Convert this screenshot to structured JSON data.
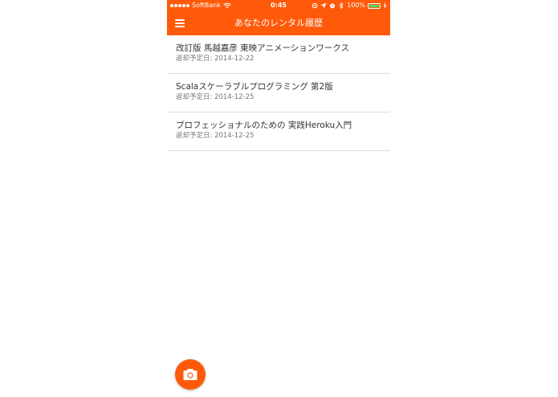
{
  "colors": {
    "accent": "#ff5a0a",
    "battery": "#4cd964"
  },
  "status_bar": {
    "carrier": "SoftBank",
    "time": "0:45",
    "battery_percent": "100%",
    "icons": [
      "signal-dots-icon",
      "wifi-icon",
      "location-icon",
      "alarm-icon",
      "bluetooth-icon",
      "battery-icon",
      "charging-icon"
    ]
  },
  "navbar": {
    "title": "あなたのレンタル履歴",
    "menu_icon": "hamburger-menu-icon"
  },
  "rentals": [
    {
      "title": "改訂版 馬越嘉彦 東映アニメーションワークス",
      "due": "返却予定日: 2014-12-22"
    },
    {
      "title": "Scalaスケーラブルプログラミング 第2版",
      "due": "返却予定日: 2014-12-25"
    },
    {
      "title": "プロフェッショナルのための 実践Heroku入門",
      "due": "返却予定日: 2014-12-25"
    }
  ],
  "fab": {
    "icon": "camera-icon"
  }
}
